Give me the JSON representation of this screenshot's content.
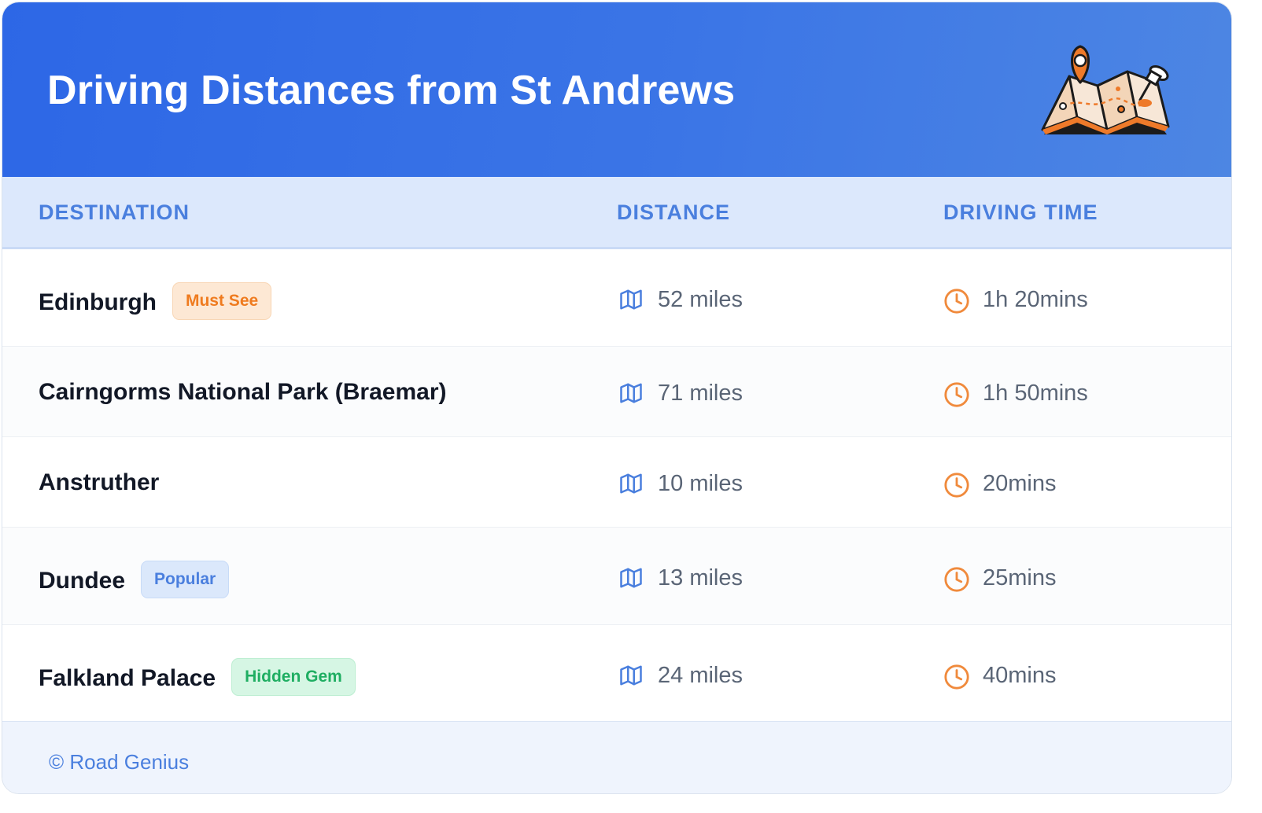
{
  "header": {
    "title": "Driving Distances from St Andrews"
  },
  "table": {
    "columns": [
      "DESTINATION",
      "DISTANCE",
      "DRIVING TIME"
    ],
    "rows": [
      {
        "destination": "Edinburgh",
        "badge": "Must See",
        "distance": "52 miles",
        "time": "1h 20mins"
      },
      {
        "destination": "Cairngorms National Park (Braemar)",
        "badge": "",
        "distance": "71 miles",
        "time": "1h 50mins"
      },
      {
        "destination": "Anstruther",
        "badge": "",
        "distance": "10 miles",
        "time": "20mins"
      },
      {
        "destination": "Dundee",
        "badge": "Popular",
        "distance": "13 miles",
        "time": "25mins"
      },
      {
        "destination": "Falkland Palace",
        "badge": "Hidden Gem",
        "distance": "24 miles",
        "time": "40mins"
      }
    ]
  },
  "footer": {
    "credit": "© Road Genius"
  },
  "icons": {
    "distance": "map-icon",
    "time": "clock-icon",
    "header": "map-pin-illustration"
  },
  "colors": {
    "header_gradient_start": "#2d67e6",
    "header_gradient_end": "#4d86e3",
    "column_header_text": "#4a7fde",
    "must_see_badge": "#ef7b1f",
    "popular_badge": "#4a7fde",
    "hidden_gem_badge": "#1fae62",
    "clock_icon": "#f08a3c",
    "map_icon": "#4a7fde"
  }
}
